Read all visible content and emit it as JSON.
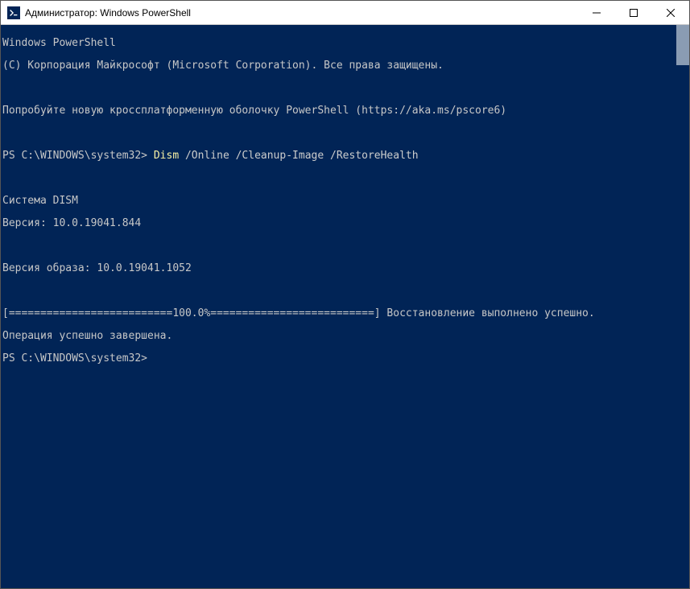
{
  "titlebar": {
    "title": "Администратор: Windows PowerShell"
  },
  "terminal": {
    "header1": "Windows PowerShell",
    "header2": "(C) Корпорация Майкрософт (Microsoft Corporation). Все права защищены.",
    "tryline": "Попробуйте новую кроссплатформенную оболочку PowerShell (https://aka.ms/pscore6)",
    "prompt1_path": "PS C:\\WINDOWS\\system32> ",
    "prompt1_cmd": "Dism",
    "prompt1_args": " /Online /Cleanup-Image /RestoreHealth",
    "dism_title": "Cистема DISM",
    "dism_version": "Версия: 10.0.19041.844",
    "image_version": "Версия образа: 10.0.19041.1052",
    "progress": "[==========================100.0%==========================] Восстановление выполнено успешно.",
    "op_done": "Операция успешно завершена.",
    "prompt2_path": "PS C:\\WINDOWS\\system32>"
  }
}
